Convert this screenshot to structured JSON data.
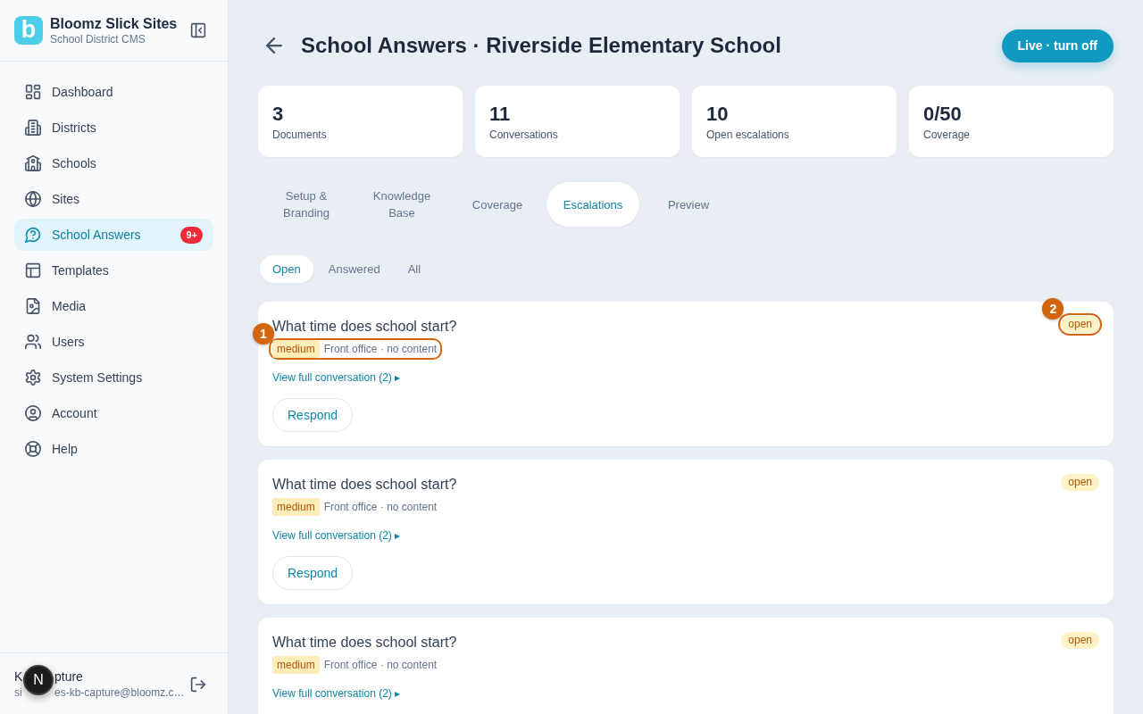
{
  "sidebar": {
    "logo": "b",
    "title": "Bloomz Slick Sites",
    "subtitle": "School District CMS",
    "items": [
      {
        "label": "Dashboard",
        "selected": false
      },
      {
        "label": "Districts",
        "selected": false
      },
      {
        "label": "Schools",
        "selected": false
      },
      {
        "label": "Sites",
        "selected": false
      },
      {
        "label": "School Answers",
        "selected": true,
        "badge": "9+"
      },
      {
        "label": "Templates",
        "selected": false
      },
      {
        "label": "Media",
        "selected": false
      },
      {
        "label": "Users",
        "selected": false
      },
      {
        "label": "System Settings",
        "selected": false
      },
      {
        "label": "Account",
        "selected": false
      },
      {
        "label": "Help",
        "selected": false
      }
    ],
    "user": {
      "name": [
        "K",
        "pture"
      ],
      "email": [
        "si",
        "es-kb-capture@bloomz.c…"
      ]
    }
  },
  "dev_indicator": {
    "label": "N"
  },
  "header": {
    "title": "School Answers · Riverside Elementary School",
    "live_button": "Live · turn off"
  },
  "stats": [
    {
      "value": "3",
      "label": "Documents"
    },
    {
      "value": "11",
      "label": "Conversations"
    },
    {
      "value": "10",
      "label": "Open escalations"
    },
    {
      "value": "0/50",
      "label": "Coverage"
    }
  ],
  "tabs": [
    {
      "label": "Setup & Branding",
      "selected": false
    },
    {
      "label": "Knowledge Base",
      "selected": false
    },
    {
      "label": "Coverage",
      "selected": false
    },
    {
      "label": "Escalations",
      "selected": true
    },
    {
      "label": "Preview",
      "selected": false
    }
  ],
  "filters": [
    {
      "label": "Open",
      "selected": true
    },
    {
      "label": "Answered",
      "selected": false
    },
    {
      "label": "All",
      "selected": false
    }
  ],
  "escalations": [
    {
      "question": "What time does school start?",
      "priority": "medium",
      "source": "Front office · no content",
      "meta_marker": "1",
      "status": "open",
      "status_marker": "2",
      "link": "View full conversation (2) ▸",
      "action": "Respond"
    },
    {
      "question": "What time does school start?",
      "priority": "medium",
      "source": "Front office · no content",
      "status": "open",
      "link": "View full conversation (2) ▸",
      "action": "Respond"
    },
    {
      "question": "What time does school start?",
      "priority": "medium",
      "source": "Front office · no content",
      "status": "open",
      "link": "View full conversation (2) ▸"
    }
  ]
}
